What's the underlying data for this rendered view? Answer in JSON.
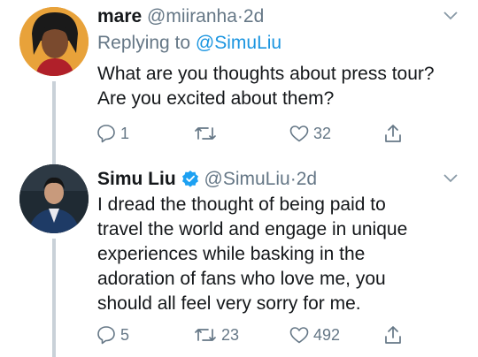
{
  "tweets": [
    {
      "author_name": "mare",
      "handle": "@miiranha",
      "separator": "·",
      "time": "2d",
      "replying_prefix": "Replying to",
      "replying_to": "@SimuLiu",
      "text": "What are you thoughts about press tour?\nAre you excited about them?",
      "reply_count": "1",
      "retweet_count": "",
      "like_count": "32"
    },
    {
      "author_name": "Simu Liu",
      "verified": true,
      "handle": "@SimuLiu",
      "separator": "·",
      "time": "2d",
      "text": "I dread the thought of being paid to\ntravel the world and engage in unique\nexperiences while basking in the\nadoration of fans who love me, you\nshould all feel very sorry for me.",
      "reply_count": "5",
      "retweet_count": "23",
      "like_count": "492"
    }
  ],
  "icons": [
    "reply-icon",
    "retweet-icon",
    "like-icon",
    "share-icon",
    "caret-down-icon",
    "verified-badge-icon"
  ],
  "colors": {
    "text": "#14171a",
    "secondary": "#657786",
    "link": "#1b95e0",
    "thread_line": "#c9d1d8"
  }
}
